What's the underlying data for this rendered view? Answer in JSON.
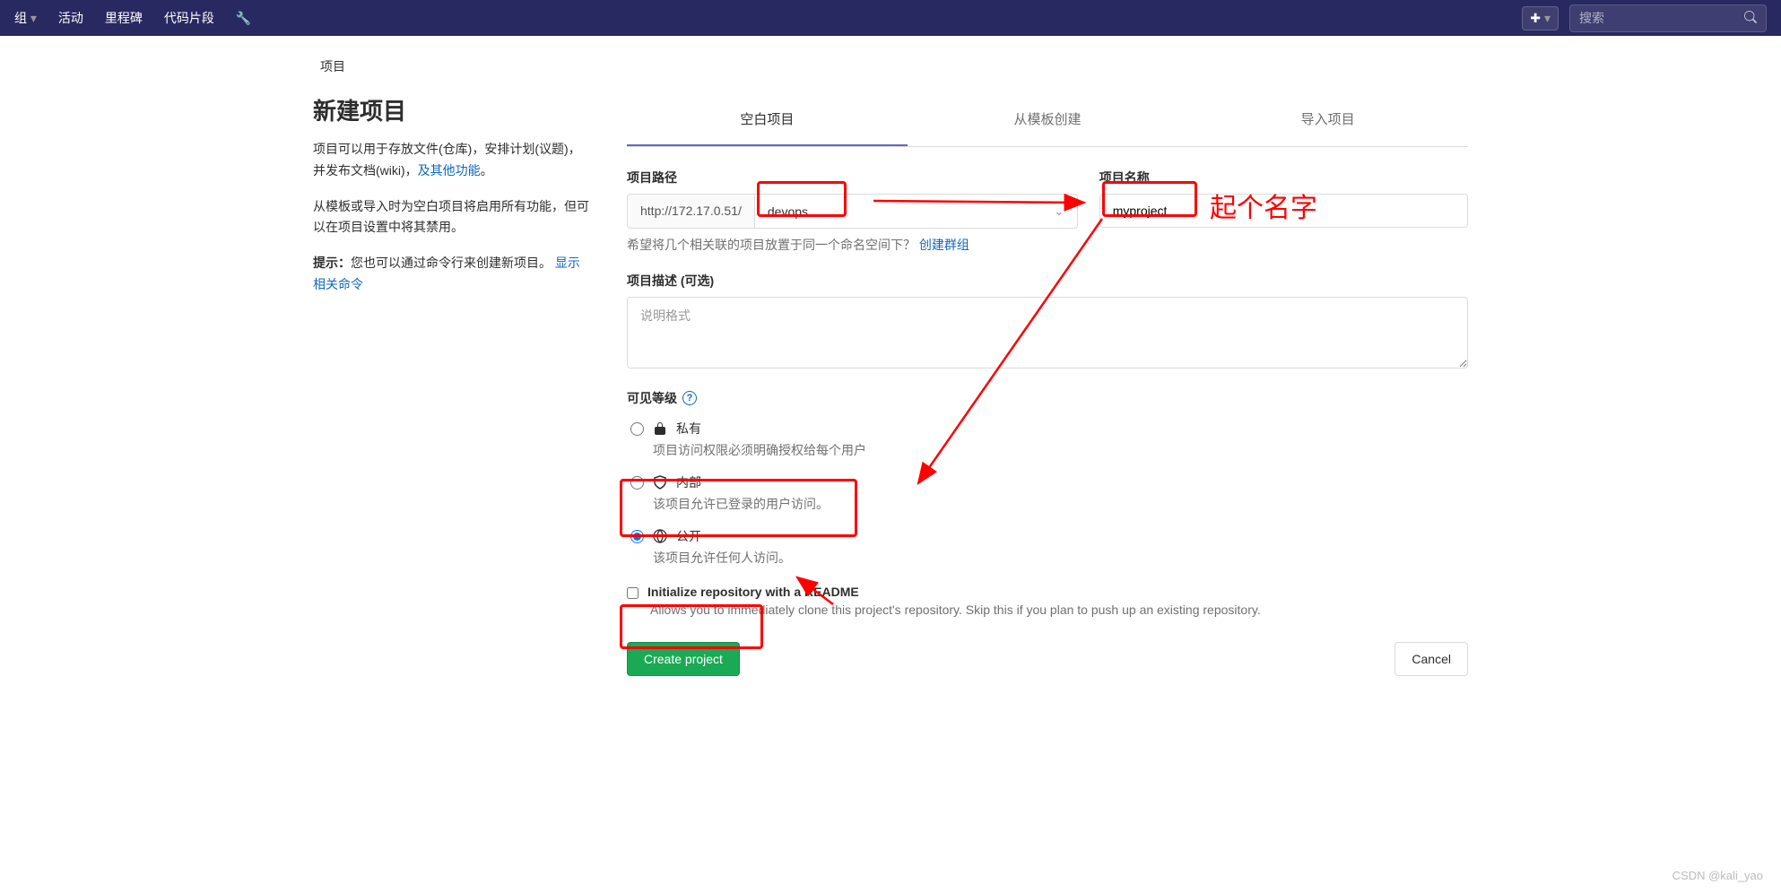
{
  "nav": {
    "items": [
      "组",
      "活动",
      "里程碑",
      "代码片段"
    ],
    "search_placeholder": "搜索"
  },
  "breadcrumb": "项目",
  "sidebar": {
    "title": "新建项目",
    "p1a": "项目可以用于存放文件(仓库)，安排计划(议题)，并发布文档(wiki)，",
    "p1_link": "及其他功能",
    "p1b": "。",
    "p2": "从模板或导入时为空白项目将启用所有功能，但可以在项目设置中将其禁用。",
    "tip_label": "提示：",
    "tip_text": "您也可以通过命令行来创建新项目。",
    "tip_link": "显示相关命令"
  },
  "tabs": [
    "空白项目",
    "从模板创建",
    "导入项目"
  ],
  "form": {
    "path_label": "项目路径",
    "path_prefix": "http://172.17.0.51/",
    "path_namespace": "devops",
    "name_label": "项目名称",
    "name_value": "myproject",
    "helper_text": "希望将几个相关联的项目放置于同一个命名空间下？",
    "helper_link": "创建群组",
    "desc_label": "项目描述 (可选)",
    "desc_placeholder": "说明格式",
    "vis_label": "可见等级",
    "vis_options": [
      {
        "title": "私有",
        "desc": "项目访问权限必须明确授权给每个用户"
      },
      {
        "title": "内部",
        "desc": "该项目允许已登录的用户访问。"
      },
      {
        "title": "公开",
        "desc": "该项目允许任何人访问。"
      }
    ],
    "readme_label": "Initialize repository with a README",
    "readme_desc": "Allows you to immediately clone this project's repository. Skip this if you plan to push up an existing repository.",
    "submit": "Create project",
    "cancel": "Cancel"
  },
  "annotations": {
    "name_hint": "起个名字"
  },
  "watermark": "CSDN @kali_yao"
}
